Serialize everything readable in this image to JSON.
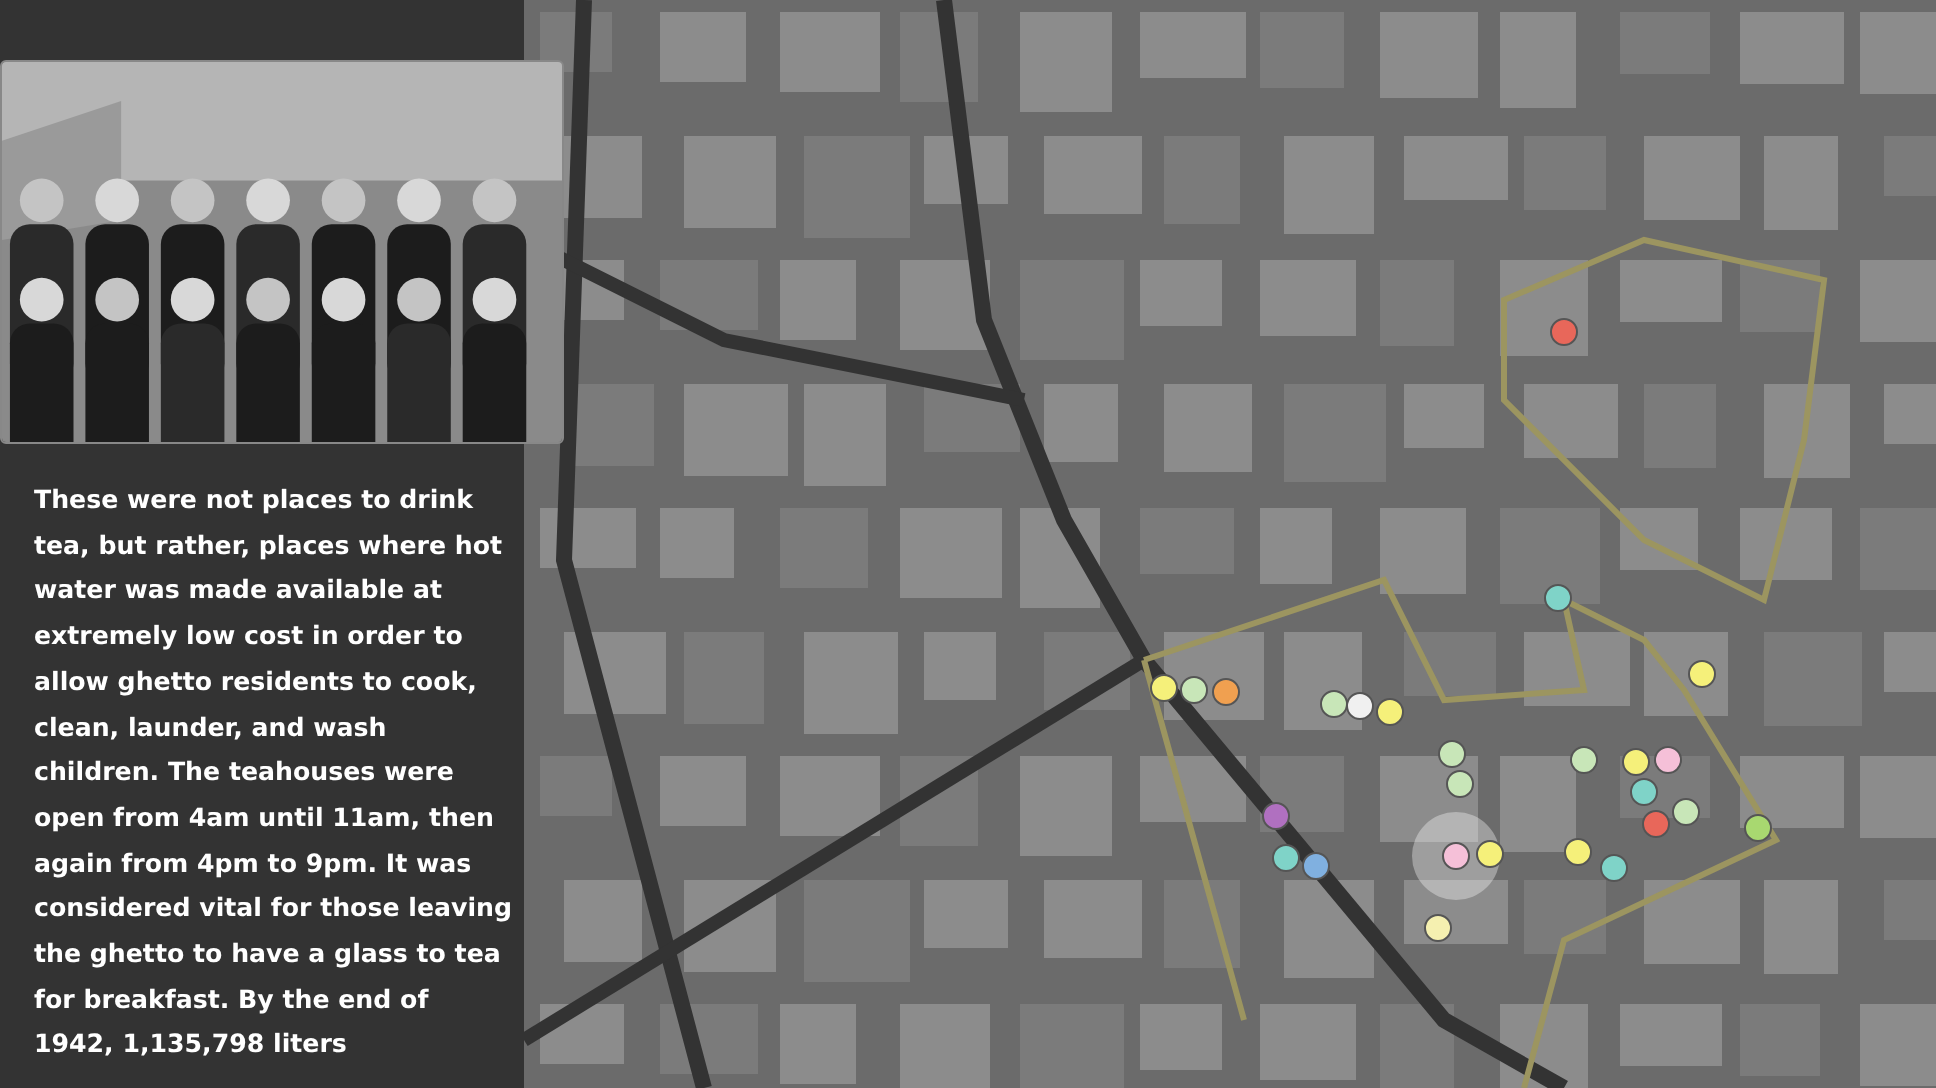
{
  "sidebar": {
    "paragraph": "These were not places to drink tea, but rather, places where hot water was made available at extremely low cost in order to allow ghetto residents to cook, clean, launder, and wash children. The teahouses were open from 4am until 11am, then again from 4pm to 9pm. It was considered vital for those leaving the ghetto to have a glass to tea for breakfast. By the end of 1942, 1,135,798 liters"
  },
  "map": {
    "kind": "picture",
    "markers": [
      {
        "color": "#e8675a",
        "selected": false
      },
      {
        "color": "#7fd3c8",
        "selected": false
      },
      {
        "color": "#f5f07a",
        "selected": false
      },
      {
        "color": "#f5f07a",
        "selected": false
      },
      {
        "color": "#c8e6b8",
        "selected": false
      },
      {
        "color": "#f0a050",
        "selected": false
      },
      {
        "color": "#c8e6b8",
        "selected": false
      },
      {
        "color": "#f0f0f0",
        "selected": false
      },
      {
        "color": "#f5f07a",
        "selected": false
      },
      {
        "color": "#c8e6b8",
        "selected": false
      },
      {
        "color": "#c8e6b8",
        "selected": false
      },
      {
        "color": "#c8e6b8",
        "selected": false
      },
      {
        "color": "#f5f07a",
        "selected": false
      },
      {
        "color": "#f5c0d8",
        "selected": false
      },
      {
        "color": "#7fd3c8",
        "selected": false
      },
      {
        "color": "#b070c0",
        "selected": false
      },
      {
        "color": "#c8e6b8",
        "selected": false
      },
      {
        "color": "#e8675a",
        "selected": false
      },
      {
        "color": "#a8d870",
        "selected": false
      },
      {
        "color": "#7fd3c8",
        "selected": false
      },
      {
        "color": "#80b0e0",
        "selected": false
      },
      {
        "color": "#f5c0d8",
        "selected": true
      },
      {
        "color": "#f5f07a",
        "selected": false
      },
      {
        "color": "#f5f07a",
        "selected": false
      },
      {
        "color": "#7fd3c8",
        "selected": false
      },
      {
        "color": "#f5f0b0",
        "selected": false
      }
    ]
  }
}
